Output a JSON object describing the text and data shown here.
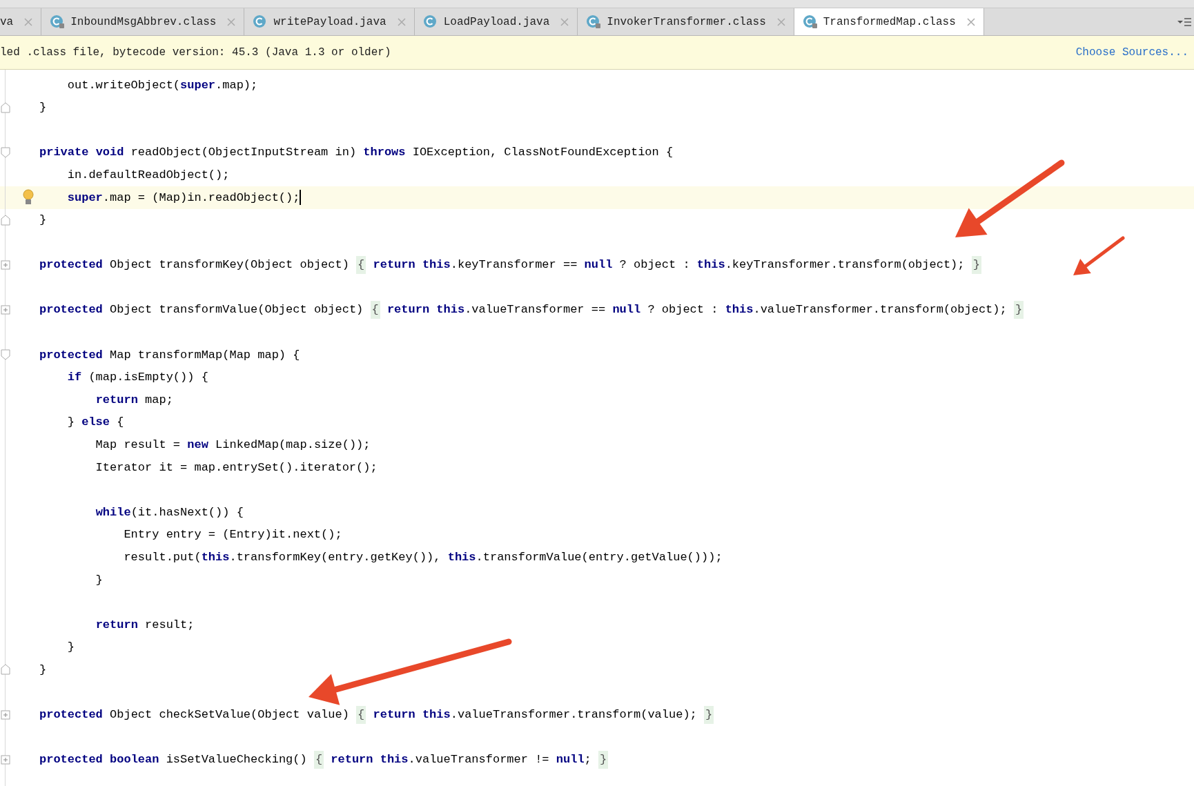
{
  "tabs": [
    {
      "label": "va",
      "kind": "partial",
      "selected": false
    },
    {
      "label": "InboundMsgAbbrev.class",
      "kind": "class",
      "selected": false
    },
    {
      "label": "writePayload.java",
      "kind": "java",
      "selected": false
    },
    {
      "label": "LoadPayload.java",
      "kind": "java",
      "selected": false
    },
    {
      "label": "InvokerTransformer.class",
      "kind": "class",
      "selected": false
    },
    {
      "label": "TransformedMap.class",
      "kind": "class",
      "selected": true
    }
  ],
  "notification": {
    "message": "led .class file, bytecode version: 45.3 (Java 1.3 or older)",
    "action": "Choose Sources..."
  },
  "code_lines": [
    {
      "kind": "plain",
      "current": false,
      "segments": [
        {
          "kind": "code",
          "text": "    out.writeObject(**super**.map);"
        }
      ]
    },
    {
      "kind": "fold-end",
      "current": false,
      "segments": [
        {
          "kind": "code",
          "text": "}"
        }
      ]
    },
    {
      "kind": "blank",
      "current": false
    },
    {
      "kind": "fold-start",
      "current": false,
      "segments": [
        {
          "kind": "code",
          "text": "**private** **void** readObject(ObjectInputStream in) **throws** IOException, ClassNotFoundException {"
        }
      ]
    },
    {
      "kind": "plain",
      "current": false,
      "segments": [
        {
          "kind": "code",
          "text": "    in.defaultReadObject();"
        }
      ]
    },
    {
      "kind": "plain",
      "current": true,
      "segments": [
        {
          "kind": "code",
          "text": "    **super**.map = (Map)in.readObject();"
        }
      ]
    },
    {
      "kind": "fold-end",
      "current": false,
      "segments": [
        {
          "kind": "code",
          "text": "}"
        }
      ]
    },
    {
      "kind": "blank",
      "current": false
    },
    {
      "kind": "collapsed",
      "current": false,
      "segments": [
        {
          "kind": "code",
          "text": "**protected** Object transformKey(Object object) "
        },
        {
          "kind": "fold",
          "text": "{"
        },
        {
          "kind": "code",
          "text": " **return** **this**.keyTransformer == **null** ? object : **this**.keyTransformer.transform(object); "
        },
        {
          "kind": "fold",
          "text": "}"
        }
      ]
    },
    {
      "kind": "blank",
      "current": false
    },
    {
      "kind": "collapsed",
      "current": false,
      "segments": [
        {
          "kind": "code",
          "text": "**protected** Object transformValue(Object object) "
        },
        {
          "kind": "fold",
          "text": "{"
        },
        {
          "kind": "code",
          "text": " **return** **this**.valueTransformer == **null** ? object : **this**.valueTransformer.transform(object); "
        },
        {
          "kind": "fold",
          "text": "}"
        }
      ]
    },
    {
      "kind": "blank",
      "current": false
    },
    {
      "kind": "fold-start",
      "current": false,
      "segments": [
        {
          "kind": "code",
          "text": "**protected** Map transformMap(Map map) {"
        }
      ]
    },
    {
      "kind": "plain",
      "current": false,
      "segments": [
        {
          "kind": "code",
          "text": "    **if** (map.isEmpty()) {"
        }
      ]
    },
    {
      "kind": "plain",
      "current": false,
      "segments": [
        {
          "kind": "code",
          "text": "        **return** map;"
        }
      ]
    },
    {
      "kind": "plain",
      "current": false,
      "segments": [
        {
          "kind": "code",
          "text": "    } **else** {"
        }
      ]
    },
    {
      "kind": "plain",
      "current": false,
      "segments": [
        {
          "kind": "code",
          "text": "        Map result = **new** LinkedMap(map.size());"
        }
      ]
    },
    {
      "kind": "plain",
      "current": false,
      "segments": [
        {
          "kind": "code",
          "text": "        Iterator it = map.entrySet().iterator();"
        }
      ]
    },
    {
      "kind": "blank",
      "current": false
    },
    {
      "kind": "plain",
      "current": false,
      "segments": [
        {
          "kind": "code",
          "text": "        **while**(it.hasNext()) {"
        }
      ]
    },
    {
      "kind": "plain",
      "current": false,
      "segments": [
        {
          "kind": "code",
          "text": "            Entry entry = (Entry)it.next();"
        }
      ]
    },
    {
      "kind": "plain",
      "current": false,
      "segments": [
        {
          "kind": "code",
          "text": "            result.put(**this**.transformKey(entry.getKey()), **this**.transformValue(entry.getValue()));"
        }
      ]
    },
    {
      "kind": "plain",
      "current": false,
      "segments": [
        {
          "kind": "code",
          "text": "        }"
        }
      ]
    },
    {
      "kind": "blank",
      "current": false
    },
    {
      "kind": "plain",
      "current": false,
      "segments": [
        {
          "kind": "code",
          "text": "        **return** result;"
        }
      ]
    },
    {
      "kind": "plain",
      "current": false,
      "segments": [
        {
          "kind": "code",
          "text": "    }"
        }
      ]
    },
    {
      "kind": "fold-end",
      "current": false,
      "segments": [
        {
          "kind": "code",
          "text": "}"
        }
      ]
    },
    {
      "kind": "blank",
      "current": false
    },
    {
      "kind": "collapsed",
      "current": false,
      "segments": [
        {
          "kind": "code",
          "text": "**protected** Object checkSetValue(Object value) "
        },
        {
          "kind": "fold",
          "text": "{"
        },
        {
          "kind": "code",
          "text": " **return** **this**.valueTransformer.transform(value); "
        },
        {
          "kind": "fold",
          "text": "}"
        }
      ]
    },
    {
      "kind": "blank",
      "current": false
    },
    {
      "kind": "collapsed",
      "current": false,
      "segments": [
        {
          "kind": "code",
          "text": "**protected** **boolean** isSetValueChecking() "
        },
        {
          "kind": "fold",
          "text": "{"
        },
        {
          "kind": "code",
          "text": " **return** **this**.valueTransformer != **null**; "
        },
        {
          "kind": "fold",
          "text": "}"
        }
      ]
    }
  ]
}
